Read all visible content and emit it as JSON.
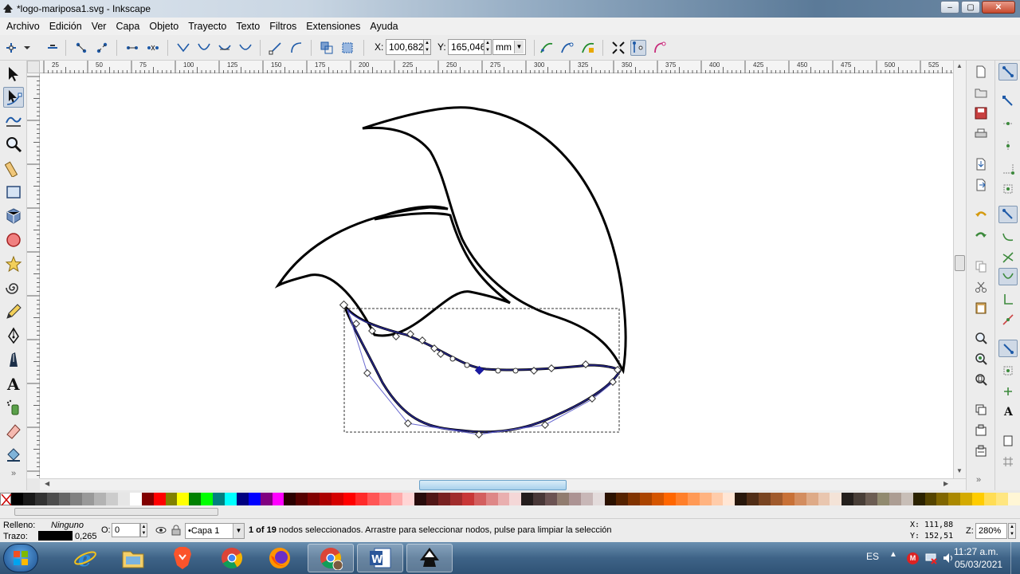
{
  "window": {
    "title": "*logo-mariposa1.svg - Inkscape",
    "min_label": "–",
    "max_label": "▢",
    "close_label": "✕"
  },
  "menu": [
    "Archivo",
    "Edición",
    "Ver",
    "Capa",
    "Objeto",
    "Trayecto",
    "Texto",
    "Filtros",
    "Extensiones",
    "Ayuda"
  ],
  "tool_controls": {
    "x_label": "X:",
    "x_value": "100,682",
    "y_label": "Y:",
    "y_value": "165,046",
    "unit": "mm"
  },
  "ruler": {
    "labels": [
      "25",
      "50",
      "75",
      "100",
      "125",
      "150",
      "175",
      "200",
      "225",
      "250",
      "275",
      "300",
      "325",
      "350",
      "375",
      "400",
      "425",
      "450",
      "475",
      "500",
      "525",
      "550"
    ]
  },
  "status": {
    "fill_label": "Relleno:",
    "fill_value": "Ninguno",
    "stroke_label": "Trazo:",
    "stroke_width": "0,265",
    "opacity_label": "O:",
    "opacity_value": "0",
    "layer": "•Capa 1",
    "message_bold": "1 of 19",
    "message": " nodos seleccionados. Arrastre para seleccionar nodos, pulse para limpiar la selección",
    "cursor_x_label": "X:",
    "cursor_x": "111,88",
    "cursor_y_label": "Y:",
    "cursor_y": "152,51",
    "zoom_label": "Z:",
    "zoom": "280%"
  },
  "taskbar": {
    "lang": "ES",
    "time": "11:27 a.m.",
    "date": "05/03/2021"
  },
  "colors": {
    "path_stroke": "#000000",
    "selected_path": "#1a1a8a",
    "selection_handles": "#3a3ab0",
    "active_tool_bg": "#cfd9e6"
  },
  "palette": [
    "#000000",
    "#1a1a1a",
    "#333333",
    "#4d4d4d",
    "#666666",
    "#808080",
    "#999999",
    "#b3b3b3",
    "#cccccc",
    "#e6e6e6",
    "#ffffff",
    "#800000",
    "#ff0000",
    "#808000",
    "#ffff00",
    "#008000",
    "#00ff00",
    "#008080",
    "#00ffff",
    "#000080",
    "#0000ff",
    "#800080",
    "#ff00ff",
    "#2b0000",
    "#550000",
    "#800000",
    "#aa0000",
    "#d40000",
    "#ff0000",
    "#ff2a2a",
    "#ff5555",
    "#ff8080",
    "#ffaaaa",
    "#ffd5d5",
    "#280b0b",
    "#501616",
    "#782121",
    "#a02c2c",
    "#c83737",
    "#d35f5f",
    "#de8787",
    "#e9afaf",
    "#f4d7d7",
    "#241c1c",
    "#483737",
    "#6c5353",
    "#917c6f",
    "#ac9393",
    "#c8b7b7",
    "#e3dbdb",
    "#2b1100",
    "#552200",
    "#803300",
    "#aa4400",
    "#d45500",
    "#ff6600",
    "#ff7f2a",
    "#ff9955",
    "#ffb380",
    "#ffccaa",
    "#ffe6d5",
    "#28170b",
    "#502d16",
    "#784421",
    "#a05a2c",
    "#c87137",
    "#d38d5f",
    "#deaa87",
    "#e9c6af",
    "#f4e3d7",
    "#241f1c",
    "#483e37",
    "#6c5d53",
    "#918a6f",
    "#ac9d93",
    "#c8beb7",
    "#2b2200",
    "#554400",
    "#806600",
    "#aa8800",
    "#d4aa00",
    "#ffcc00",
    "#ffdd55",
    "#ffe680",
    "#fff6d5"
  ]
}
